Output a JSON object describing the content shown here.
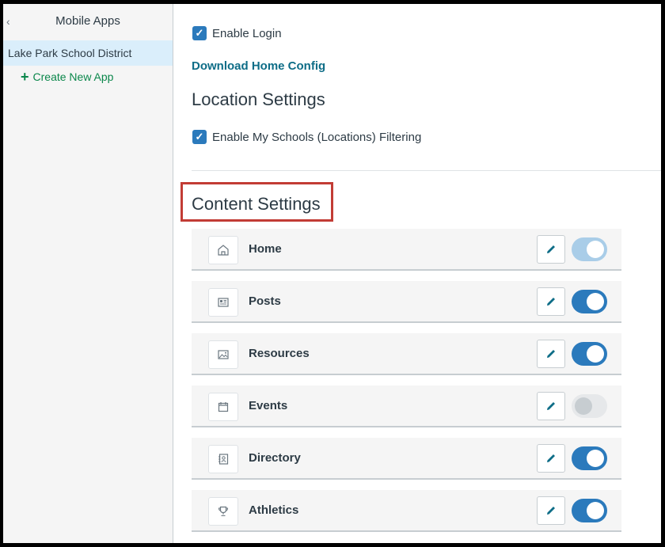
{
  "sidebar": {
    "title": "Mobile Apps",
    "back_icon": "chevron-left-icon",
    "items": [
      {
        "label": "Lake Park School District"
      }
    ],
    "create_label": "Create New App"
  },
  "main": {
    "enable_login_label": "Enable Login",
    "download_link": "Download Home Config",
    "location_heading": "Location Settings",
    "filtering_label": "Enable My Schools (Locations) Filtering",
    "content_heading": "Content Settings",
    "rows": [
      {
        "label": "Home",
        "icon": "home-icon",
        "toggle": "on-disabled"
      },
      {
        "label": "Posts",
        "icon": "newspaper-icon",
        "toggle": "on"
      },
      {
        "label": "Resources",
        "icon": "image-icon",
        "toggle": "on"
      },
      {
        "label": "Events",
        "icon": "calendar-icon",
        "toggle": "off"
      },
      {
        "label": "Directory",
        "icon": "address-book-icon",
        "toggle": "on"
      },
      {
        "label": "Athletics",
        "icon": "trophy-icon",
        "toggle": "on"
      }
    ]
  },
  "colors": {
    "accent": "#2b7abc",
    "link": "#0e6d87",
    "create": "#0b874b",
    "highlight": "#c23c35"
  }
}
